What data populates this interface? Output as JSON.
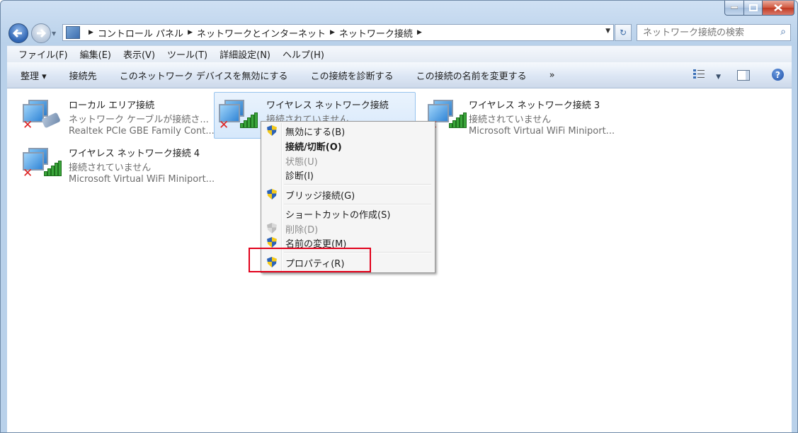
{
  "address": {
    "crumbs": [
      "コントロール パネル",
      "ネットワークとインターネット",
      "ネットワーク接続"
    ]
  },
  "search": {
    "placeholder": "ネットワーク接続の検索"
  },
  "menubar": [
    "ファイル(F)",
    "編集(E)",
    "表示(V)",
    "ツール(T)",
    "詳細設定(N)",
    "ヘルプ(H)"
  ],
  "commands": {
    "organize": "整理 ▾",
    "connect_to": "接続先",
    "disable": "このネットワーク デバイスを無効にする",
    "diagnose": "この接続を診断する",
    "rename": "この接続の名前を変更する",
    "more": "»"
  },
  "connections": [
    {
      "name": "ローカル エリア接続",
      "status": "ネットワーク ケーブルが接続さ...",
      "device": "Realtek PCIe GBE Family Cont..."
    },
    {
      "name": "ワイヤレス ネットワーク接続",
      "status": "接続されていません",
      "device": ""
    },
    {
      "name": "ワイヤレス ネットワーク接続 3",
      "status": "接続されていません",
      "device": "Microsoft Virtual WiFi Miniport..."
    },
    {
      "name": "ワイヤレス ネットワーク接続 4",
      "status": "接続されていません",
      "device": "Microsoft Virtual WiFi Miniport..."
    }
  ],
  "context_menu": {
    "disable": "無効にする(B)",
    "connect": "接続/切断(O)",
    "status": "状態(U)",
    "diagnose": "診断(I)",
    "bridge": "ブリッジ接続(G)",
    "shortcut": "ショートカットの作成(S)",
    "delete": "削除(D)",
    "rename": "名前の変更(M)",
    "properties": "プロパティ(R)"
  },
  "colors": {
    "highlight_box": "#e1001a",
    "signal_green": "#3aa53a",
    "disconnected_x": "#dd2222"
  },
  "icons": [
    "back-arrow",
    "forward-arrow",
    "refresh",
    "search",
    "network-adapter",
    "red-x",
    "signal-bars",
    "uac-shield",
    "help"
  ]
}
